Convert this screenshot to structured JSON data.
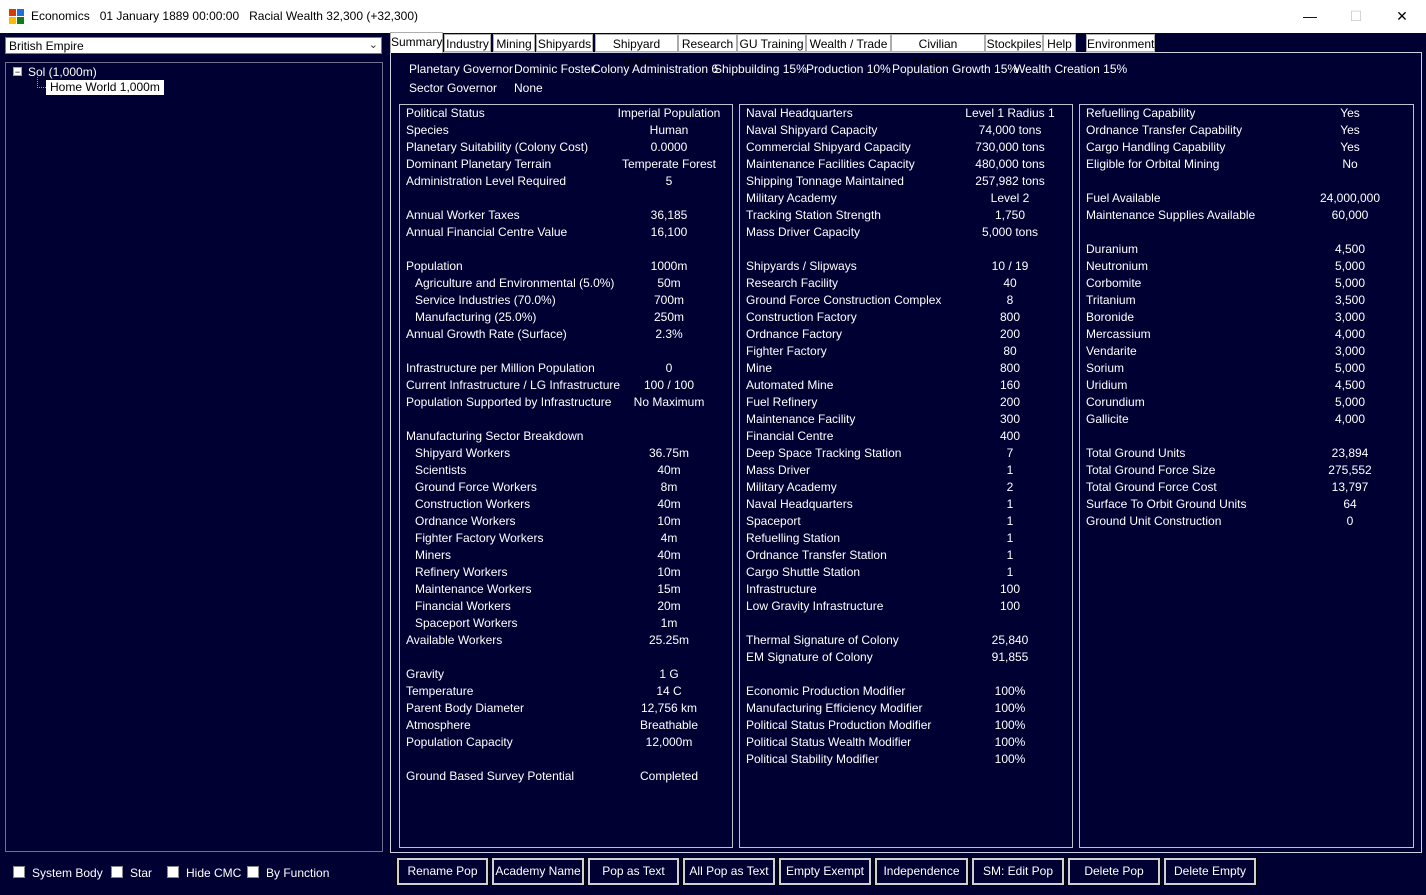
{
  "window": {
    "title": "Economics   01 January 1889 00:00:00   Racial Wealth 32,300 (+32,300)",
    "minimize": "—",
    "maximize": "☐",
    "close": "✕"
  },
  "sidebar": {
    "empire": "British Empire",
    "tree": {
      "expander": "−",
      "system": "Sol  (1,000m)",
      "body": "Home World  1,000m"
    },
    "checkboxes": [
      "System Body",
      "Star",
      "Hide CMC",
      "By Function"
    ]
  },
  "tabs": [
    "Summary",
    "Industry",
    "Mining",
    "Shipyards",
    "Shipyard Tasks",
    "Research",
    "GU Training",
    "Wealth / Trade",
    "Civilian Economy",
    "Stockpiles",
    "Help",
    "Environment"
  ],
  "governor": {
    "planetary_label": "Planetary Governor",
    "planetary_name": "Dominic Foster",
    "bonuses": [
      "Colony Administration 6",
      "Shipbuilding 15%",
      "Production 10%",
      "Population Growth 15%",
      "Wealth Creation 15%"
    ],
    "sector_label": "Sector Governor",
    "sector_name": "None"
  },
  "col1": [
    {
      "label": "Political Status",
      "value": "Imperial Population"
    },
    {
      "label": "Species",
      "value": "Human"
    },
    {
      "label": "Planetary Suitability (Colony Cost)",
      "value": "0.0000"
    },
    {
      "label": "Dominant Planetary Terrain",
      "value": "Temperate Forest"
    },
    {
      "label": "Administration Level Required",
      "value": "5"
    },
    {
      "label": "",
      "value": ""
    },
    {
      "label": "Annual Worker Taxes",
      "value": "36,185"
    },
    {
      "label": "Annual Financial Centre Value",
      "value": "16,100"
    },
    {
      "label": "",
      "value": ""
    },
    {
      "label": "Population",
      "value": "1000m"
    },
    {
      "label": "Agriculture and Environmental (5.0%)",
      "value": "50m",
      "indent": true
    },
    {
      "label": "Service Industries (70.0%)",
      "value": "700m",
      "indent": true
    },
    {
      "label": "Manufacturing (25.0%)",
      "value": "250m",
      "indent": true
    },
    {
      "label": "Annual Growth Rate (Surface)",
      "value": "2.3%"
    },
    {
      "label": "",
      "value": ""
    },
    {
      "label": "Infrastructure per Million Population",
      "value": "0"
    },
    {
      "label": "Current Infrastructure / LG Infrastructure",
      "value": "100 / 100"
    },
    {
      "label": "Population Supported by Infrastructure",
      "value": "No Maximum"
    },
    {
      "label": "",
      "value": ""
    },
    {
      "label": "Manufacturing Sector Breakdown",
      "value": ""
    },
    {
      "label": "Shipyard Workers",
      "value": "36.75m",
      "indent": true
    },
    {
      "label": "Scientists",
      "value": "40m",
      "indent": true
    },
    {
      "label": "Ground Force Workers",
      "value": "8m",
      "indent": true
    },
    {
      "label": "Construction Workers",
      "value": "40m",
      "indent": true
    },
    {
      "label": "Ordnance Workers",
      "value": "10m",
      "indent": true
    },
    {
      "label": "Fighter Factory Workers",
      "value": "4m",
      "indent": true
    },
    {
      "label": "Miners",
      "value": "40m",
      "indent": true
    },
    {
      "label": "Refinery Workers",
      "value": "10m",
      "indent": true
    },
    {
      "label": "Maintenance Workers",
      "value": "15m",
      "indent": true
    },
    {
      "label": "Financial Workers",
      "value": "20m",
      "indent": true
    },
    {
      "label": "Spaceport Workers",
      "value": "1m",
      "indent": true
    },
    {
      "label": "Available Workers",
      "value": "25.25m"
    },
    {
      "label": "",
      "value": ""
    },
    {
      "label": "Gravity",
      "value": "1 G"
    },
    {
      "label": "Temperature",
      "value": "14 C"
    },
    {
      "label": "Parent Body Diameter",
      "value": "12,756 km"
    },
    {
      "label": "Atmosphere",
      "value": "Breathable"
    },
    {
      "label": "Population Capacity",
      "value": "12,000m"
    },
    {
      "label": "",
      "value": ""
    },
    {
      "label": "Ground Based Survey Potential",
      "value": "Completed"
    }
  ],
  "col2": [
    {
      "label": "Naval Headquarters",
      "value": "Level 1  Radius 1"
    },
    {
      "label": "Naval Shipyard Capacity",
      "value": "74,000 tons"
    },
    {
      "label": "Commercial Shipyard Capacity",
      "value": "730,000 tons"
    },
    {
      "label": "Maintenance Facilities Capacity",
      "value": "480,000 tons"
    },
    {
      "label": "Shipping Tonnage Maintained",
      "value": "257,982 tons"
    },
    {
      "label": "Military Academy",
      "value": "Level 2"
    },
    {
      "label": "Tracking Station Strength",
      "value": "1,750"
    },
    {
      "label": "Mass Driver Capacity",
      "value": "5,000 tons"
    },
    {
      "label": "",
      "value": ""
    },
    {
      "label": "Shipyards / Slipways",
      "value": "10 / 19"
    },
    {
      "label": "Research Facility",
      "value": "40"
    },
    {
      "label": "Ground Force Construction Complex",
      "value": "8"
    },
    {
      "label": "Construction Factory",
      "value": "800"
    },
    {
      "label": "Ordnance Factory",
      "value": "200"
    },
    {
      "label": "Fighter Factory",
      "value": "80"
    },
    {
      "label": "Mine",
      "value": "800"
    },
    {
      "label": "Automated Mine",
      "value": "160"
    },
    {
      "label": "Fuel Refinery",
      "value": "200"
    },
    {
      "label": "Maintenance Facility",
      "value": "300"
    },
    {
      "label": "Financial Centre",
      "value": "400"
    },
    {
      "label": "Deep Space Tracking Station",
      "value": "7"
    },
    {
      "label": "Mass Driver",
      "value": "1"
    },
    {
      "label": "Military Academy",
      "value": "2"
    },
    {
      "label": "Naval Headquarters",
      "value": "1"
    },
    {
      "label": "Spaceport",
      "value": "1"
    },
    {
      "label": "Refuelling Station",
      "value": "1"
    },
    {
      "label": "Ordnance Transfer Station",
      "value": "1"
    },
    {
      "label": "Cargo Shuttle Station",
      "value": "1"
    },
    {
      "label": "Infrastructure",
      "value": "100"
    },
    {
      "label": "Low Gravity Infrastructure",
      "value": "100"
    },
    {
      "label": "",
      "value": ""
    },
    {
      "label": "Thermal Signature of Colony",
      "value": "25,840"
    },
    {
      "label": "EM Signature of Colony",
      "value": "91,855"
    },
    {
      "label": "",
      "value": ""
    },
    {
      "label": "Economic Production Modifier",
      "value": "100%"
    },
    {
      "label": "Manufacturing Efficiency Modifier",
      "value": "100%"
    },
    {
      "label": "Political Status Production Modifier",
      "value": "100%"
    },
    {
      "label": "Political Status Wealth Modifier",
      "value": "100%"
    },
    {
      "label": "Political Stability Modifier",
      "value": "100%"
    }
  ],
  "col3": [
    {
      "label": "Refuelling Capability",
      "value": "Yes"
    },
    {
      "label": "Ordnance Transfer Capability",
      "value": "Yes"
    },
    {
      "label": "Cargo Handling Capability",
      "value": "Yes"
    },
    {
      "label": "Eligible for Orbital Mining",
      "value": "No"
    },
    {
      "label": "",
      "value": ""
    },
    {
      "label": "Fuel Available",
      "value": "24,000,000"
    },
    {
      "label": "Maintenance Supplies Available",
      "value": "60,000"
    },
    {
      "label": "",
      "value": ""
    },
    {
      "label": "Duranium",
      "value": "4,500"
    },
    {
      "label": "Neutronium",
      "value": "5,000"
    },
    {
      "label": "Corbomite",
      "value": "5,000"
    },
    {
      "label": "Tritanium",
      "value": "3,500"
    },
    {
      "label": "Boronide",
      "value": "3,000"
    },
    {
      "label": "Mercassium",
      "value": "4,000"
    },
    {
      "label": "Vendarite",
      "value": "3,000"
    },
    {
      "label": "Sorium",
      "value": "5,000"
    },
    {
      "label": "Uridium",
      "value": "4,500"
    },
    {
      "label": "Corundium",
      "value": "5,000"
    },
    {
      "label": "Gallicite",
      "value": "4,000"
    },
    {
      "label": "",
      "value": ""
    },
    {
      "label": "Total Ground Units",
      "value": "23,894"
    },
    {
      "label": "Total Ground Force Size",
      "value": "275,552"
    },
    {
      "label": "Total Ground Force Cost",
      "value": "13,797"
    },
    {
      "label": "Surface To Orbit Ground Units",
      "value": "64"
    },
    {
      "label": "Ground Unit Construction",
      "value": "0"
    }
  ],
  "buttons": [
    "Rename Pop",
    "Academy Name",
    "Pop as Text",
    "All Pop as Text",
    "Empty Exempt",
    "Independence",
    "SM: Edit Pop",
    "Delete Pop",
    "Delete Empty"
  ]
}
